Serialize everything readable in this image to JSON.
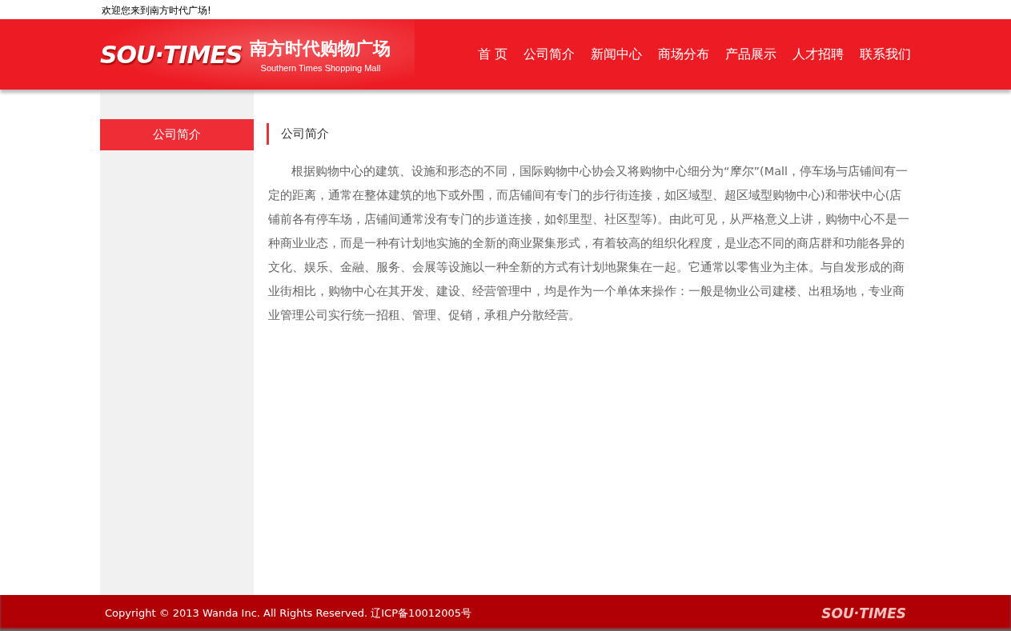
{
  "top_bar": {
    "welcome": "欢迎您来到南方时代广场!"
  },
  "header": {
    "logo_mark": "SOU·TIMES",
    "logo_title": "南方时代购物广场",
    "logo_subtitle": "Southern Times Shopping Mall",
    "nav": [
      "首 页",
      "公司简介",
      "新闻中心",
      "商场分布",
      "产品展示",
      "人才招聘",
      "联系我们"
    ]
  },
  "sidebar": {
    "items": [
      {
        "label": "公司简介",
        "selected": true
      }
    ]
  },
  "content": {
    "title": "公司简介",
    "paragraph": "根据购物中心的建筑、设施和形态的不同，国际购物中心协会又将购物中心细分为“摩尔”(Mall，停车场与店铺间有一定的距离，通常在整体建筑的地下或外围，而店铺间有专门的步行街连接，如区域型、超区域型购物中心)和带状中心(店铺前各有停车场，店铺间通常没有专门的步道连接，如邻里型、社区型等)。由此可见，从严格意义上讲，购物中心不是一种商业业态，而是一种有计划地实施的全新的商业聚集形式，有着较高的组织化程度，是业态不同的商店群和功能各异的文化、娱乐、金融、服务、会展等设施以一种全新的方式有计划地聚集在一起。它通常以零售业为主体。与自发形成的商业街相比，购物中心在其开发、建设、经营管理中，均是作为一个单体来操作：一般是物业公司建楼、出租场地，专业商业管理公司实行统一招租、管理、促销，承租户分散经营。"
  },
  "footer": {
    "copyright": "Copyright © 2013 Wanda Inc. All Rights Reserved. 辽ICP备10012005号",
    "logo_mark": "SOU·TIMES"
  }
}
